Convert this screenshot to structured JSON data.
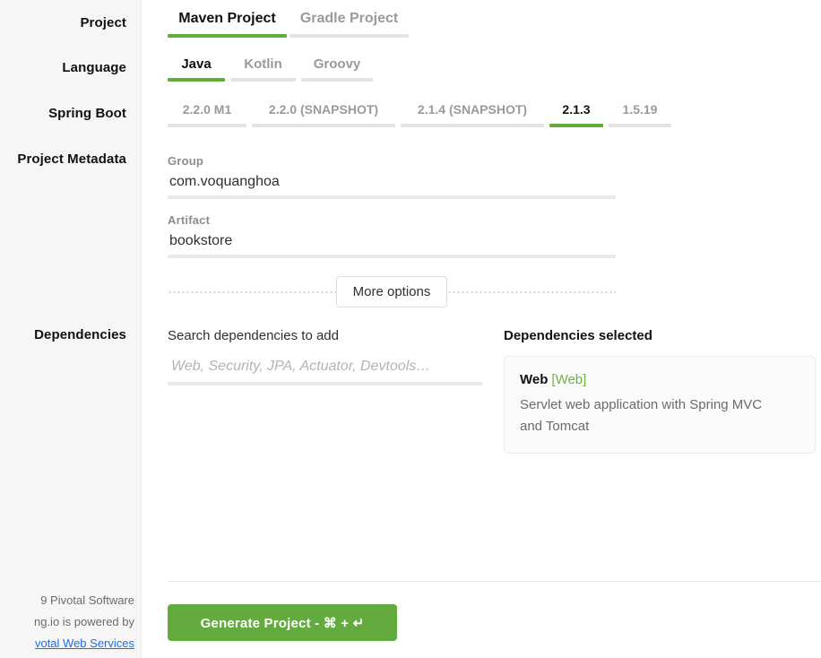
{
  "sidebar": {
    "labels": [
      {
        "key": "project",
        "text": "Project"
      },
      {
        "key": "language",
        "text": "Language"
      },
      {
        "key": "spring_boot",
        "text": "Spring Boot"
      },
      {
        "key": "project_metadata",
        "text": "Project Metadata"
      },
      {
        "key": "dependencies",
        "text": "Dependencies"
      }
    ],
    "footer": {
      "line1": "9 Pivotal Software",
      "line2": "ng.io is powered by",
      "link": "votal Web Services",
      "link_color": "#1a6ff0"
    }
  },
  "project_type": {
    "tabs": [
      {
        "label": "Maven Project",
        "selected": true
      },
      {
        "label": "Gradle Project",
        "selected": false
      }
    ]
  },
  "language": {
    "tabs": [
      {
        "label": "Java",
        "selected": true
      },
      {
        "label": "Kotlin",
        "selected": false
      },
      {
        "label": "Groovy",
        "selected": false
      }
    ]
  },
  "spring_boot": {
    "tabs": [
      {
        "label": "2.2.0 M1",
        "selected": false
      },
      {
        "label": "2.2.0 (SNAPSHOT)",
        "selected": false
      },
      {
        "label": "2.1.4 (SNAPSHOT)",
        "selected": false
      },
      {
        "label": "2.1.3",
        "selected": true
      },
      {
        "label": "1.5.19",
        "selected": false
      }
    ]
  },
  "metadata": {
    "group": {
      "label": "Group",
      "value": "com.voquanghoa"
    },
    "artifact": {
      "label": "Artifact",
      "value": "bookstore"
    },
    "more_options_label": "More options"
  },
  "dependencies": {
    "search_title": "Search dependencies to add",
    "search_placeholder": "Web, Security, JPA, Actuator, Devtools…",
    "search_value": "",
    "selected_title": "Dependencies selected",
    "selected": [
      {
        "name": "Web",
        "tag": "[Web]",
        "description": "Servlet web application with Spring MVC and Tomcat"
      }
    ]
  },
  "actions": {
    "generate_label": "Generate Project - ⌘ + ↵"
  },
  "colors": {
    "accent_green": "#64ab3f",
    "tag_green": "#6db33f",
    "rail_background": "#f6f6f6",
    "inactive_bar": "#e3e3e3"
  }
}
